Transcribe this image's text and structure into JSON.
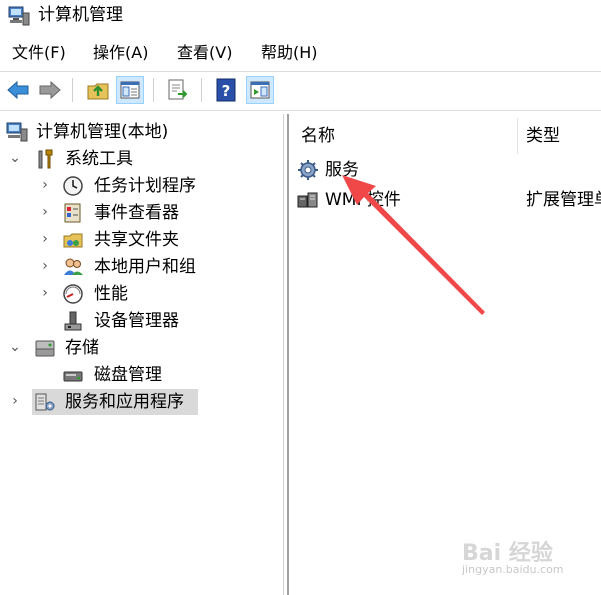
{
  "window": {
    "title": "计算机管理"
  },
  "menubar": {
    "items": [
      "文件(F)",
      "操作(A)",
      "查看(V)",
      "帮助(H)"
    ]
  },
  "tree": {
    "root": "计算机管理(本地)",
    "system_tools": "系统工具",
    "task_scheduler": "任务计划程序",
    "event_viewer": "事件查看器",
    "shared_folders": "共享文件夹",
    "local_users": "本地用户和组",
    "performance": "性能",
    "device_manager": "设备管理器",
    "storage": "存储",
    "disk_management": "磁盘管理",
    "services_apps": "服务和应用程序"
  },
  "list": {
    "headers": {
      "name": "名称",
      "type": "类型"
    },
    "rows": [
      {
        "name": "服务",
        "type": ""
      },
      {
        "name": "WMI 控件",
        "type": "扩展管理单元"
      }
    ]
  },
  "watermark": {
    "logo": "Bai 经验",
    "url": "jingyan.baidu.com"
  },
  "colors": {
    "arrow": "#f04848",
    "selection": "#d9d9d9",
    "toolbar_active": "#cde8ff"
  }
}
